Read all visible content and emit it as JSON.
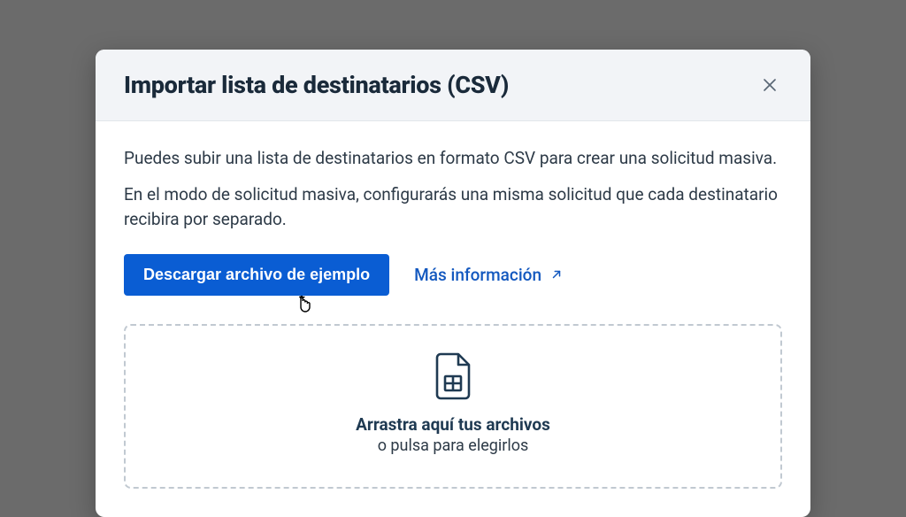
{
  "modal": {
    "title": "Importar lista de destinatarios (CSV)",
    "paragraph1": "Puedes subir una lista de destinatarios en formato CSV para crear una solicitud masiva.",
    "paragraph2": "En el modo de solicitud masiva, configurarás una misma solicitud que cada destinatario recibira por separado.",
    "download_button": "Descargar archivo de ejemplo",
    "more_info_link": "Más información",
    "dropzone": {
      "title": "Arrastra aquí tus archivos",
      "subtitle": "o pulsa para elegirlos"
    }
  }
}
